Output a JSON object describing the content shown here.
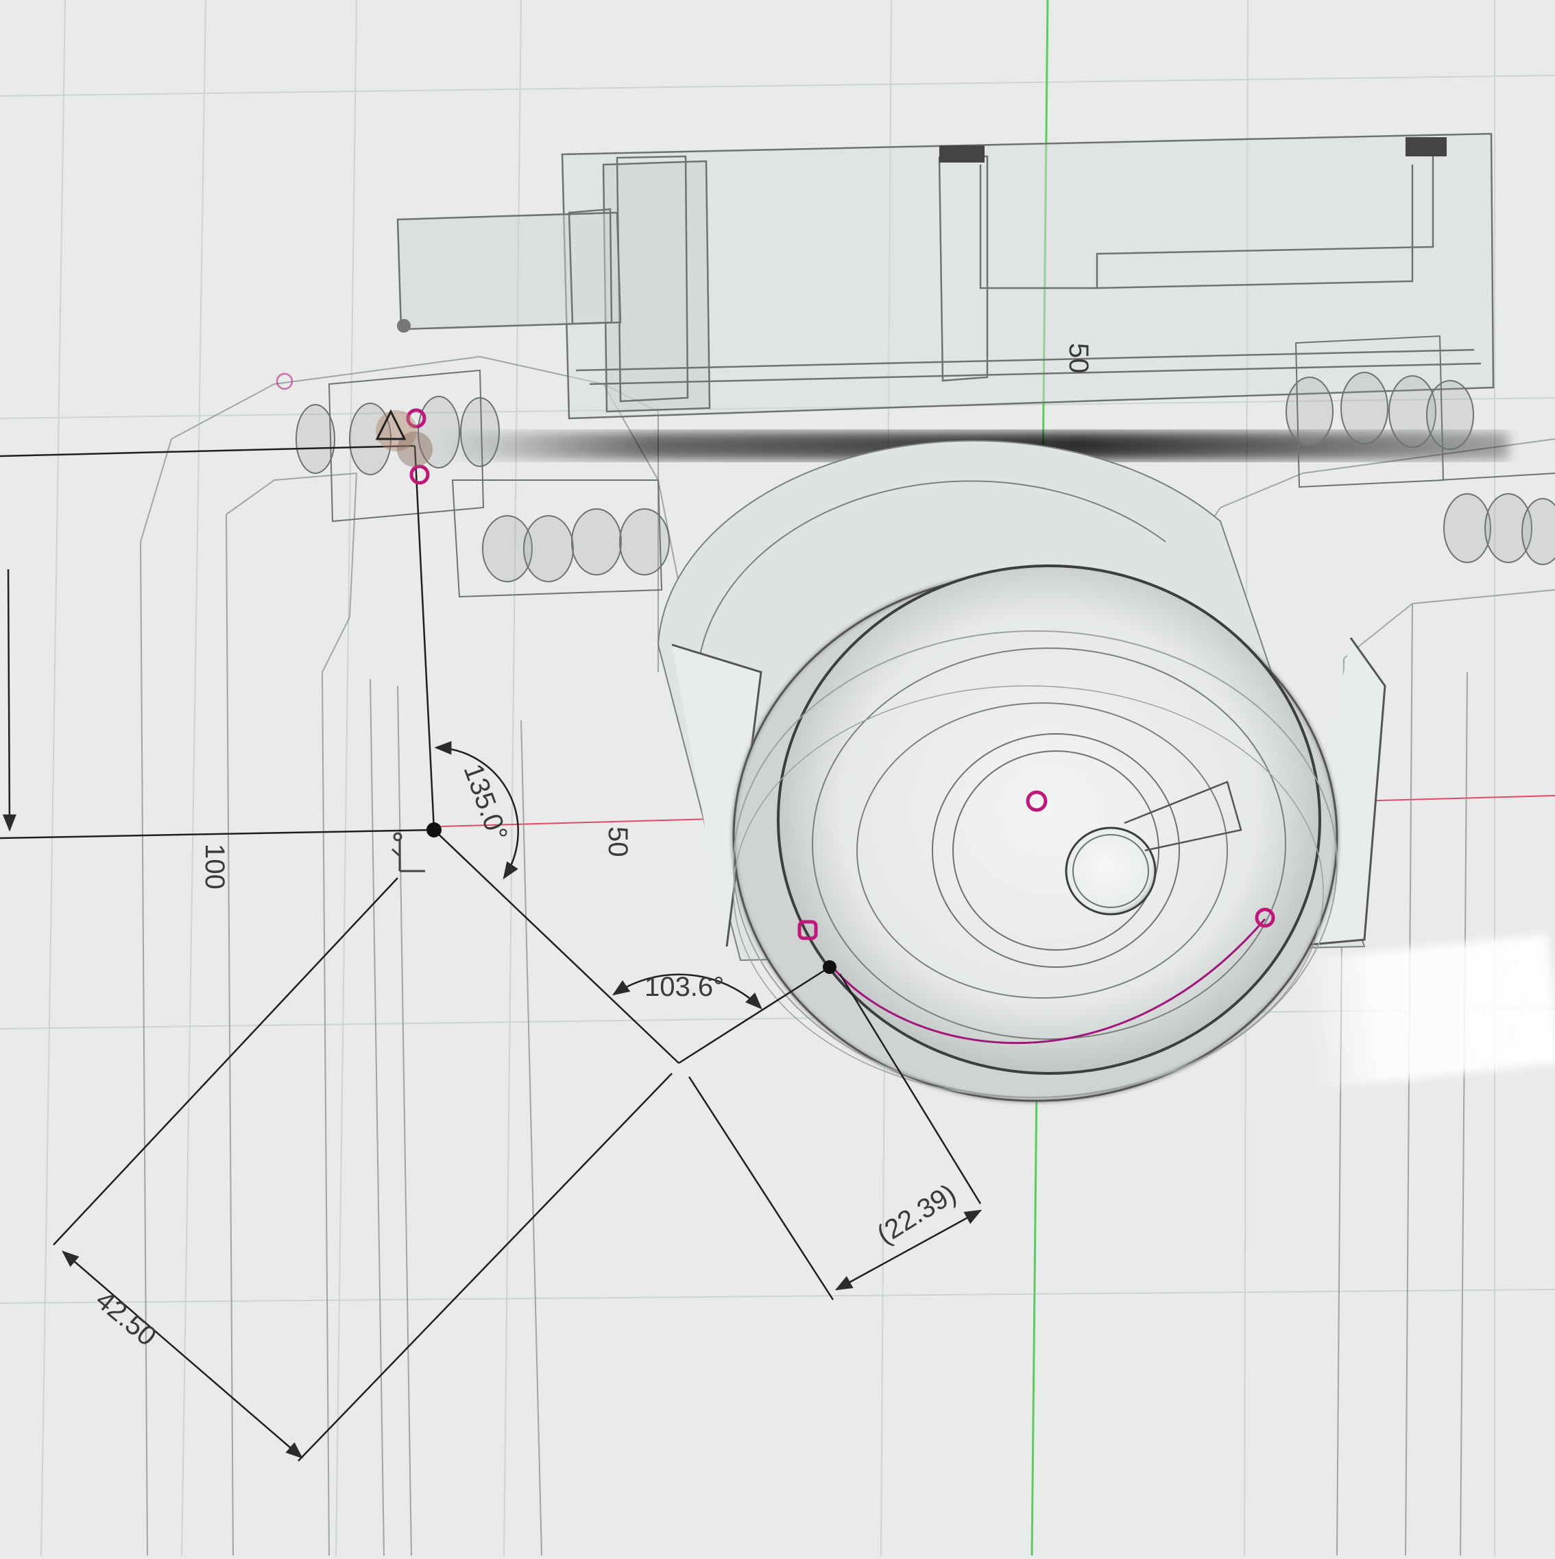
{
  "viewport": {
    "background": "#e8ebea",
    "origin_axis_color": "#5ec95e",
    "x_axis_color": "#e04a6a",
    "sketch_constraint_color": "#c0187a",
    "dimension_color": "#2b2b2b"
  },
  "dimensions": {
    "angle_main": "135.0°",
    "angle_secondary": "103.6°",
    "length_vertical": "100",
    "length_diagonal": "42.50",
    "length_reference": "(22.39)",
    "length_top_body": "50",
    "length_mid_body": "50"
  },
  "icons": {
    "origin_marker": "coordinate-triad-icon",
    "warning_marker": "warning-triangle-icon",
    "constraint_point": "sketch-point-icon"
  }
}
